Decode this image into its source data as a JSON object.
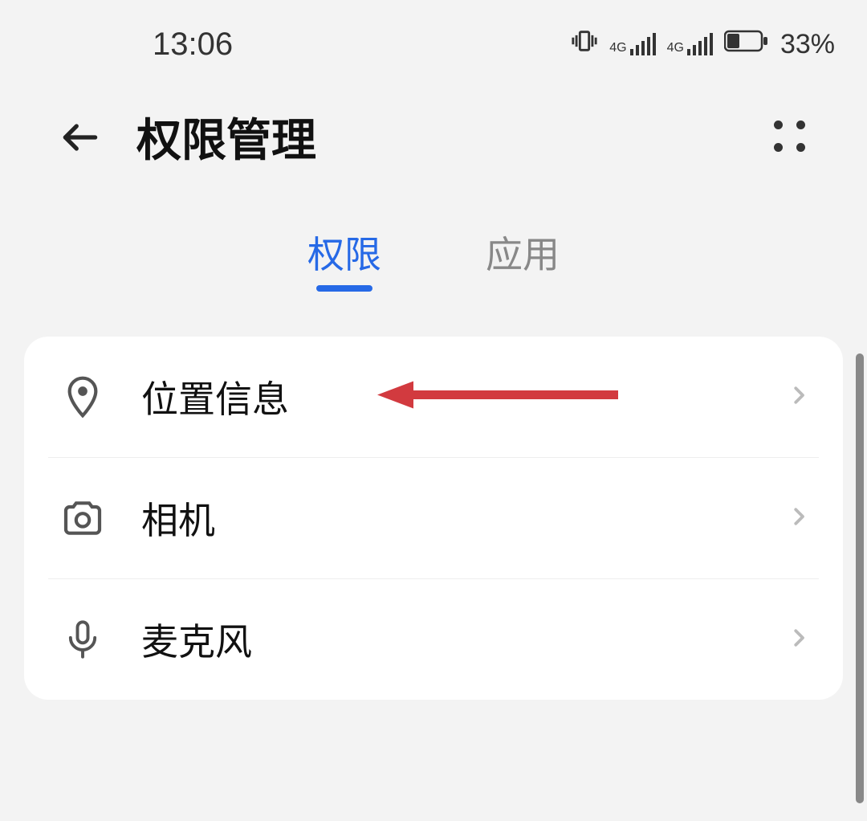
{
  "status": {
    "time": "13:06",
    "battery_percent": "33%",
    "network_label1": "4G",
    "network_label2": "4G"
  },
  "header": {
    "title": "权限管理"
  },
  "tabs": {
    "permissions": "权限",
    "apps": "应用",
    "active": "permissions"
  },
  "permissions": [
    {
      "key": "location",
      "label": "位置信息",
      "icon": "location-icon"
    },
    {
      "key": "camera",
      "label": "相机",
      "icon": "camera-icon"
    },
    {
      "key": "mic",
      "label": "麦克风",
      "icon": "microphone-icon"
    }
  ],
  "annotation": {
    "target": "location",
    "color": "#d23a3f"
  }
}
